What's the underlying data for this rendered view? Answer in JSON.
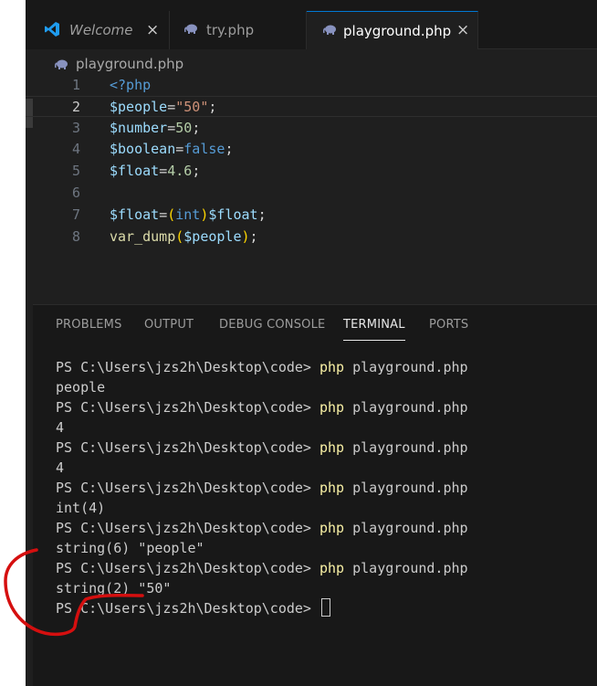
{
  "tabs": [
    {
      "label": "Welcome",
      "close": "×",
      "icon": "vscode-logo-icon"
    },
    {
      "label": "try.php",
      "close": "",
      "icon": "php-elephant-icon"
    },
    {
      "label": "playground.php",
      "close": "×",
      "icon": "php-elephant-icon"
    }
  ],
  "breadcrumb": {
    "file": "playground.php"
  },
  "editor": {
    "lines": [
      {
        "num": "1",
        "tokens": [
          {
            "t": "<?php",
            "c": "kw"
          }
        ]
      },
      {
        "num": "2",
        "tokens": [
          {
            "t": "$people",
            "c": "var"
          },
          {
            "t": "=",
            "c": "op"
          },
          {
            "t": "\"50\"",
            "c": "str"
          },
          {
            "t": ";",
            "c": "op"
          }
        ]
      },
      {
        "num": "3",
        "tokens": [
          {
            "t": "$number",
            "c": "var"
          },
          {
            "t": "=",
            "c": "op"
          },
          {
            "t": "50",
            "c": "num"
          },
          {
            "t": ";",
            "c": "op"
          }
        ]
      },
      {
        "num": "4",
        "tokens": [
          {
            "t": "$boolean",
            "c": "var"
          },
          {
            "t": "=",
            "c": "op"
          },
          {
            "t": "false",
            "c": "kw"
          },
          {
            "t": ";",
            "c": "op"
          }
        ]
      },
      {
        "num": "5",
        "tokens": [
          {
            "t": "$float",
            "c": "var"
          },
          {
            "t": "=",
            "c": "op"
          },
          {
            "t": "4.6",
            "c": "num"
          },
          {
            "t": ";",
            "c": "op"
          }
        ]
      },
      {
        "num": "6",
        "tokens": []
      },
      {
        "num": "7",
        "tokens": [
          {
            "t": "$float",
            "c": "var"
          },
          {
            "t": "=",
            "c": "op"
          },
          {
            "t": "(",
            "c": "paren"
          },
          {
            "t": "int",
            "c": "kw"
          },
          {
            "t": ")",
            "c": "paren"
          },
          {
            "t": "$float",
            "c": "var"
          },
          {
            "t": ";",
            "c": "op"
          }
        ]
      },
      {
        "num": "8",
        "tokens": [
          {
            "t": "var_dump",
            "c": "fn"
          },
          {
            "t": "(",
            "c": "paren"
          },
          {
            "t": "$people",
            "c": "var"
          },
          {
            "t": ")",
            "c": "paren"
          },
          {
            "t": ";",
            "c": "op"
          }
        ]
      }
    ]
  },
  "panel_tabs": [
    "PROBLEMS",
    "OUTPUT",
    "DEBUG CONSOLE",
    "TERMINAL",
    "PORTS"
  ],
  "terminal": {
    "prompt": "PS C:\\Users\\jzs2h\\Desktop\\code> ",
    "cmd": "php",
    "arg": " playground.php",
    "outputs": [
      "people",
      "4",
      "4",
      "int(4)",
      "string(6) \"people\"",
      "string(2) \"50\""
    ]
  }
}
